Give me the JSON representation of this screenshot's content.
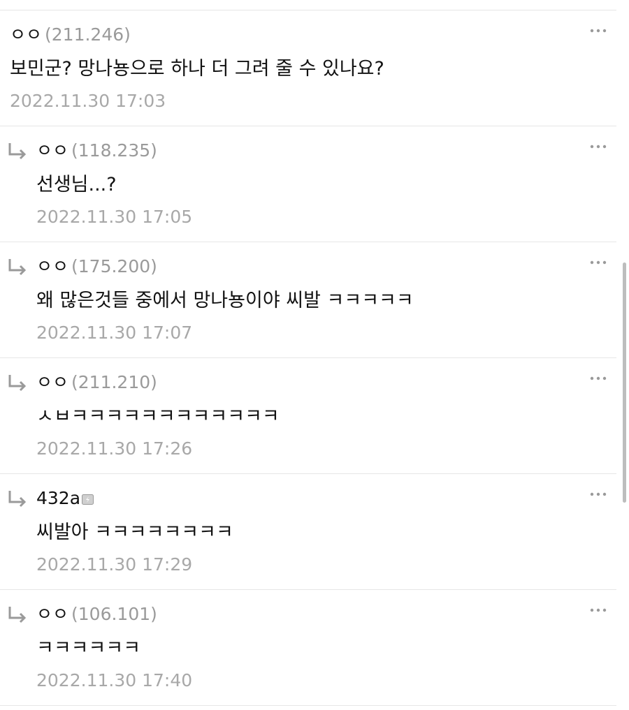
{
  "comments": [
    {
      "nick": "ㅇㅇ",
      "ip": "(211.246)",
      "body": "보민군? 망나뇽으로 하나 더 그려 줄 수 있나요?",
      "time": "2022.11.30 17:03",
      "reply": false
    },
    {
      "nick": "ㅇㅇ",
      "ip": "(118.235)",
      "body": "선생님...?",
      "time": "2022.11.30 17:05",
      "reply": true
    },
    {
      "nick": "ㅇㅇ",
      "ip": "(175.200)",
      "body": "왜 많은것들 중에서 망나뇽이야 씨발 ㅋㅋㅋㅋㅋ",
      "time": "2022.11.30 17:07",
      "reply": true
    },
    {
      "nick": "ㅇㅇ",
      "ip": "(211.210)",
      "body": "ㅅㅂㅋㅋㅋㅋㅋㅋㅋㅋㅋㅋㅋㅋ",
      "time": "2022.11.30 17:26",
      "reply": true
    },
    {
      "nick": "432a",
      "ip": "",
      "body": "씨발아 ㅋㅋㅋㅋㅋㅋㅋㅋ",
      "time": "2022.11.30 17:29",
      "reply": true
    },
    {
      "nick": "ㅇㅇ",
      "ip": "(106.101)",
      "body": "ㅋㅋㅋㅋㅋㅋ",
      "time": "2022.11.30 17:40",
      "reply": true
    }
  ],
  "icons": {
    "reply": "reply-arrow-icon",
    "more": "more-options-icon",
    "member": "member-badge-icon"
  },
  "colors": {
    "meta": "#a8a8a8",
    "text": "#111111",
    "divider": "#e6e6e6"
  }
}
